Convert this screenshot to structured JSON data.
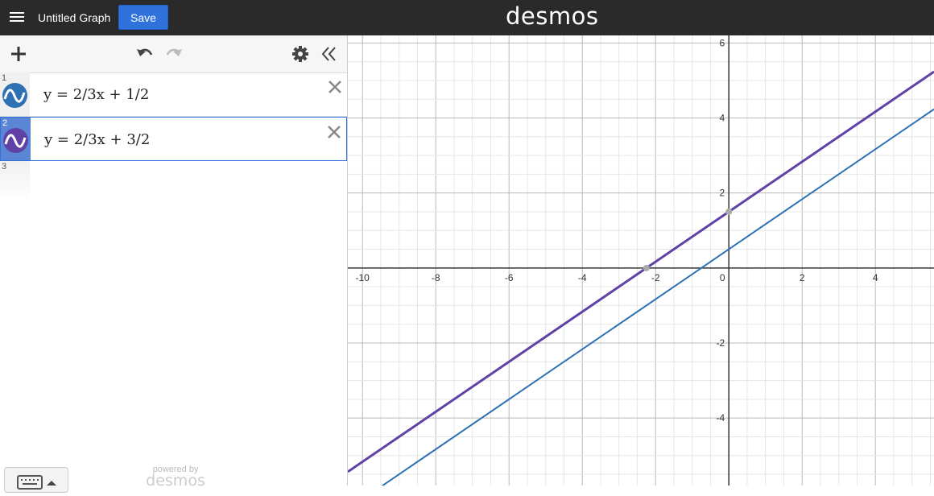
{
  "topbar": {
    "title": "Untitled Graph",
    "save_label": "Save",
    "brand": "desmos"
  },
  "toolbar": {
    "icons": [
      "plus-icon",
      "undo-icon",
      "redo-icon",
      "gear-icon",
      "collapse-icon"
    ]
  },
  "expressions": [
    {
      "index": "1",
      "latex": "y = 2/3x + 1/2",
      "color": "#2d70b3",
      "active": false
    },
    {
      "index": "2",
      "latex": "y = 2/3x + 3/2",
      "color": "#6042a6",
      "active": true
    },
    {
      "index": "3",
      "latex": ""
    }
  ],
  "footer": {
    "powered_by": "powered by",
    "logo": "desmos"
  },
  "chart_data": {
    "type": "line",
    "xlim": [
      -10.4,
      5.6
    ],
    "ylim": [
      -5.8,
      6.2
    ],
    "grid": true,
    "x_ticks": [
      "-10",
      "-8",
      "-6",
      "-4",
      "-2",
      "0",
      "2",
      "4"
    ],
    "y_ticks": [
      "6",
      "4",
      "2",
      "-2",
      "-4"
    ],
    "series": [
      {
        "slope": 0.6666667,
        "intercept": 0.5,
        "color": "#2d70b3"
      },
      {
        "slope": 0.6666667,
        "intercept": 1.5,
        "color": "#6042a6"
      }
    ],
    "points": [
      {
        "x": 0,
        "y": 1.5
      },
      {
        "x": -2.25,
        "y": 0
      }
    ]
  }
}
